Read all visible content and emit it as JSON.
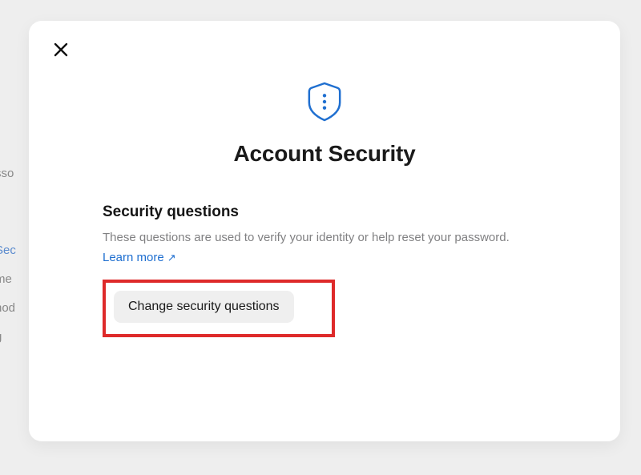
{
  "modal": {
    "title": "Account Security",
    "section": {
      "heading": "Security questions",
      "description": "These questions are used to verify your identity or help reset your password.",
      "learn_more_label": "Learn more",
      "change_button_label": "Change security questions"
    }
  },
  "background_items": [
    {
      "label": "sso"
    },
    {
      "label": "Sec",
      "blue": true
    },
    {
      "label": "me"
    },
    {
      "label": "hod"
    },
    {
      "label": "g"
    }
  ],
  "colors": {
    "accent": "#1f6fd0",
    "highlight_border": "#de2a2a"
  }
}
